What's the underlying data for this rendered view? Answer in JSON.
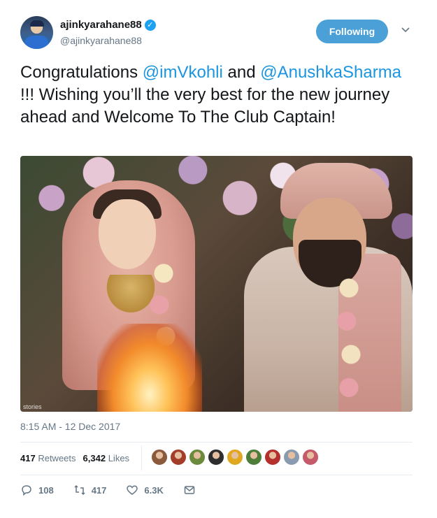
{
  "tweet": {
    "display_name": "ajinkyarahane88",
    "handle": "@ajinkyarahane88",
    "follow_label": "Following",
    "text_parts": [
      "Congratulations ",
      "@imVkohli",
      " and ",
      "@AnushkaSharma",
      " !!! Wishing you’ll the very best for the new journey ahead and Welcome To The Club Captain!"
    ],
    "photo_watermark": "stories",
    "timestamp": "8:15 AM - 12 Dec 2017",
    "retweets_count": "417",
    "retweets_label": "Retweets",
    "likes_count": "6,342",
    "likes_label": "Likes"
  },
  "actions": {
    "reply_count": "108",
    "retweet_count": "417",
    "like_count": "6.3K"
  },
  "likers": [
    "#8b5a3c",
    "#a33d2a",
    "#6b8a3b",
    "#2e2e2e",
    "#e0a820",
    "#4e7d3a",
    "#b4302e",
    "#8a9bb0",
    "#c45a6a"
  ],
  "colors": {
    "accent": "#1da1f2",
    "mention": "#1b95e0",
    "follow_button": "#4ba0d8",
    "muted": "#657786"
  },
  "icons": [
    "verified-badge-icon",
    "chevron-down-icon",
    "reply-icon",
    "retweet-icon",
    "like-icon",
    "direct-message-icon"
  ]
}
